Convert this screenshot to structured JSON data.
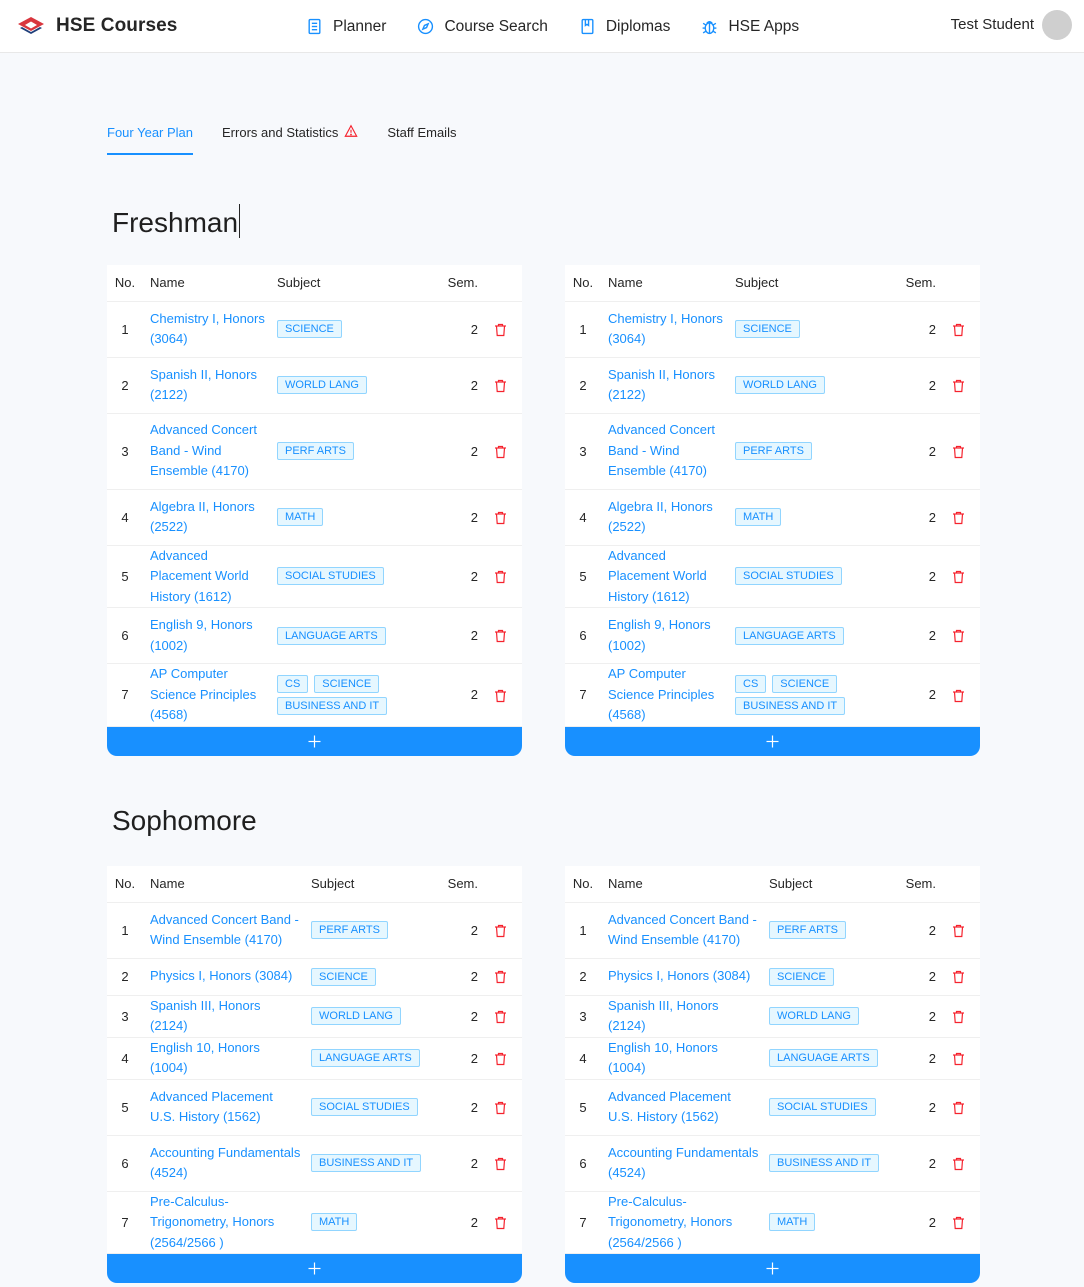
{
  "header": {
    "brand": "HSE Courses",
    "nav": [
      {
        "label": "Planner",
        "icon": "planner-icon"
      },
      {
        "label": "Course Search",
        "icon": "compass-icon"
      },
      {
        "label": "Diplomas",
        "icon": "book-icon"
      },
      {
        "label": "HSE Apps",
        "icon": "bug-icon"
      }
    ],
    "user": "Test Student"
  },
  "tabs": [
    {
      "label": "Four Year Plan",
      "active": true
    },
    {
      "label": "Errors and Statistics",
      "active": false,
      "icon": "warning-icon"
    },
    {
      "label": "Staff Emails",
      "active": false
    }
  ],
  "columns": {
    "no": "No.",
    "name": "Name",
    "subject": "Subject",
    "sem": "Sem."
  },
  "colors": {
    "accent": "#1890ff",
    "danger": "#f5222d",
    "tag_bg": "#e6f7ff",
    "tag_border": "#91d5ff"
  },
  "years": [
    {
      "title": "Freshman",
      "courses": [
        {
          "no": "1",
          "name": "Chemistry I, Honors (3064)",
          "subjects": [
            "SCIENCE"
          ],
          "sem": "2"
        },
        {
          "no": "2",
          "name": "Spanish II, Honors (2122)",
          "subjects": [
            "WORLD LANG"
          ],
          "sem": "2"
        },
        {
          "no": "3",
          "name": "Advanced Concert Band - Wind Ensemble (4170)",
          "subjects": [
            "PERF ARTS"
          ],
          "sem": "2"
        },
        {
          "no": "4",
          "name": "Algebra II, Honors (2522)",
          "subjects": [
            "MATH"
          ],
          "sem": "2"
        },
        {
          "no": "5",
          "name": "Advanced Placement World History (1612)",
          "subjects": [
            "SOCIAL STUDIES"
          ],
          "sem": "2"
        },
        {
          "no": "6",
          "name": "English 9, Honors (1002)",
          "subjects": [
            "LANGUAGE ARTS"
          ],
          "sem": "2"
        },
        {
          "no": "7",
          "name": "AP Computer Science Principles (4568)",
          "subjects": [
            "CS",
            "SCIENCE",
            "BUSINESS AND IT"
          ],
          "sem": "2"
        }
      ]
    },
    {
      "title": "Sophomore",
      "courses": [
        {
          "no": "1",
          "name": "Advanced Concert Band - Wind Ensemble (4170)",
          "subjects": [
            "PERF ARTS"
          ],
          "sem": "2"
        },
        {
          "no": "2",
          "name": "Physics I, Honors (3084)",
          "subjects": [
            "SCIENCE"
          ],
          "sem": "2"
        },
        {
          "no": "3",
          "name": "Spanish III, Honors (2124)",
          "subjects": [
            "WORLD LANG"
          ],
          "sem": "2"
        },
        {
          "no": "4",
          "name": "English 10, Honors (1004)",
          "subjects": [
            "LANGUAGE ARTS"
          ],
          "sem": "2"
        },
        {
          "no": "5",
          "name": "Advanced Placement U.S. History (1562)",
          "subjects": [
            "SOCIAL STUDIES"
          ],
          "sem": "2"
        },
        {
          "no": "6",
          "name": "Accounting Fundamentals (4524)",
          "subjects": [
            "BUSINESS AND IT"
          ],
          "sem": "2"
        },
        {
          "no": "7",
          "name": "Pre-Calculus-Trigonometry, Honors (2564/2566 )",
          "subjects": [
            "MATH"
          ],
          "sem": "2"
        }
      ]
    }
  ]
}
